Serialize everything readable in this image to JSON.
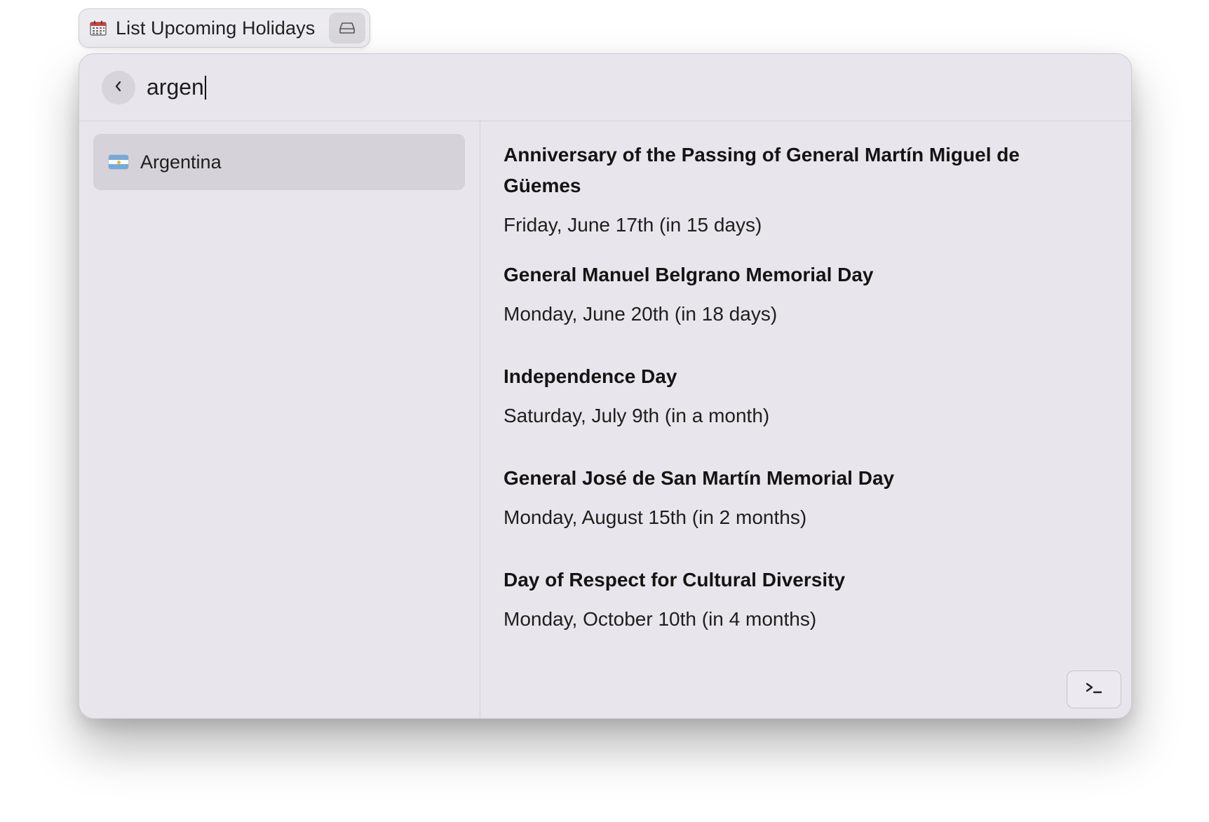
{
  "tab": {
    "title": "List Upcoming Holidays",
    "icon": "calendar-icon",
    "action_icon": "hard-drive-icon"
  },
  "search": {
    "value": "argen",
    "back_icon": "chevron-left-icon"
  },
  "sidebar": {
    "items": [
      {
        "label": "Argentina",
        "icon": "argentina-flag-icon",
        "selected": true
      }
    ]
  },
  "holidays": [
    {
      "name": "Anniversary of the Passing of General Martín Miguel de Güemes",
      "date": "Friday, June 17th (in 15 days)"
    },
    {
      "name": "General Manuel Belgrano Memorial Day",
      "date": "Monday, June 20th (in 18 days)"
    },
    {
      "name": "Independence Day",
      "date": "Saturday, July 9th (in a month)"
    },
    {
      "name": "General José de San Martín Memorial Day",
      "date": "Monday, August 15th (in 2 months)"
    },
    {
      "name": "Day of Respect for Cultural Diversity",
      "date": "Monday, October 10th (in 4 months)"
    }
  ],
  "footer": {
    "terminal_icon": "terminal-icon"
  },
  "colors": {
    "window_bg": "#e8e6ec",
    "selected_item_bg": "#d5d3d9",
    "border": "#d2d0d6"
  }
}
